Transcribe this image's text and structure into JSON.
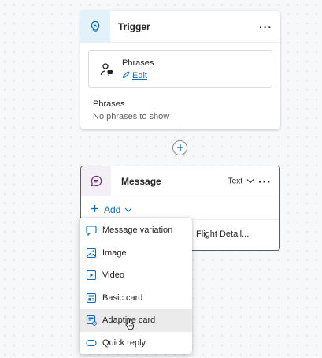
{
  "trigger": {
    "title": "Trigger",
    "more": "···",
    "phrases_box_title": "Phrases",
    "edit_link": "Edit",
    "phrases_label": "Phrases",
    "phrases_value": "No phrases to show"
  },
  "message": {
    "title": "Message",
    "type_select": "Text",
    "more": "···",
    "add_label": "Add",
    "preview_text": "Flight Detail..."
  },
  "add_menu": {
    "items": [
      {
        "label": "Message variation",
        "icon": "message-variation-icon"
      },
      {
        "label": "Image",
        "icon": "image-icon"
      },
      {
        "label": "Video",
        "icon": "video-icon"
      },
      {
        "label": "Basic card",
        "icon": "basic-card-icon"
      },
      {
        "label": "Adaptive card",
        "icon": "adaptive-card-icon",
        "hovered": true
      },
      {
        "label": "Quick reply",
        "icon": "quick-reply-icon"
      }
    ]
  },
  "colors": {
    "accent": "#0f6cbd",
    "trigger_icon_bg": "#e3f1fb",
    "message_icon_bg": "#f4eef6",
    "hover_bg": "#ebebeb"
  }
}
